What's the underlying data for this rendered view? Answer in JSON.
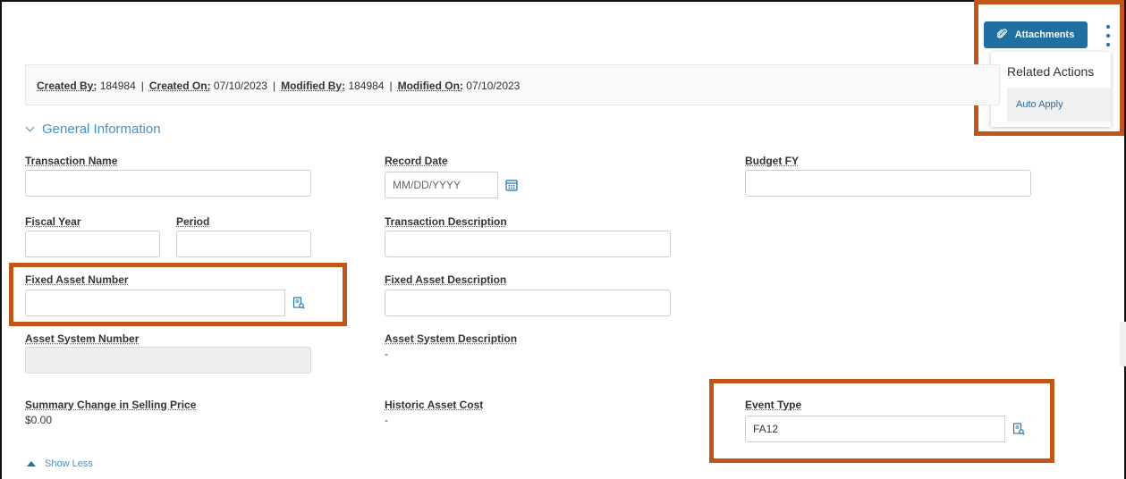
{
  "header": {
    "attachments_label": "Attachments"
  },
  "related_actions": {
    "title": "Related Actions",
    "items": [
      "Auto Apply"
    ]
  },
  "meta": {
    "created_by_label": "Created By",
    "created_by": "184984",
    "created_on_label": "Created On",
    "created_on": "07/10/2023",
    "modified_by_label": "Modified By",
    "modified_by": "184984",
    "modified_on_label": "Modified On",
    "modified_on": "07/10/2023",
    "separator": "|"
  },
  "section": {
    "title": "General Information"
  },
  "fields": {
    "transaction_name": {
      "label": "Transaction Name",
      "value": ""
    },
    "record_date": {
      "label": "Record Date",
      "value": "",
      "placeholder": "MM/DD/YYYY"
    },
    "budget_fy": {
      "label": "Budget FY",
      "value": ""
    },
    "fiscal_year": {
      "label": "Fiscal Year",
      "value": ""
    },
    "period": {
      "label": "Period",
      "value": ""
    },
    "transaction_description": {
      "label": "Transaction Description",
      "value": ""
    },
    "fixed_asset_number": {
      "label": "Fixed Asset Number",
      "value": ""
    },
    "fixed_asset_description": {
      "label": "Fixed Asset Description",
      "value": ""
    },
    "asset_system_number": {
      "label": "Asset System Number",
      "value": ""
    },
    "asset_system_description": {
      "label": "Asset System Description",
      "value": "-"
    },
    "summary_change": {
      "label": "Summary Change in Selling Price",
      "value": "$0.00"
    },
    "historic_asset_cost": {
      "label": "Historic Asset Cost",
      "value": "-"
    },
    "event_type": {
      "label": "Event Type",
      "value": "FA12"
    }
  },
  "footer": {
    "show_less": "Show Less"
  },
  "colors": {
    "accent": "#1f6fa1",
    "link": "#4a8fc2",
    "highlight": "#c0571a"
  }
}
